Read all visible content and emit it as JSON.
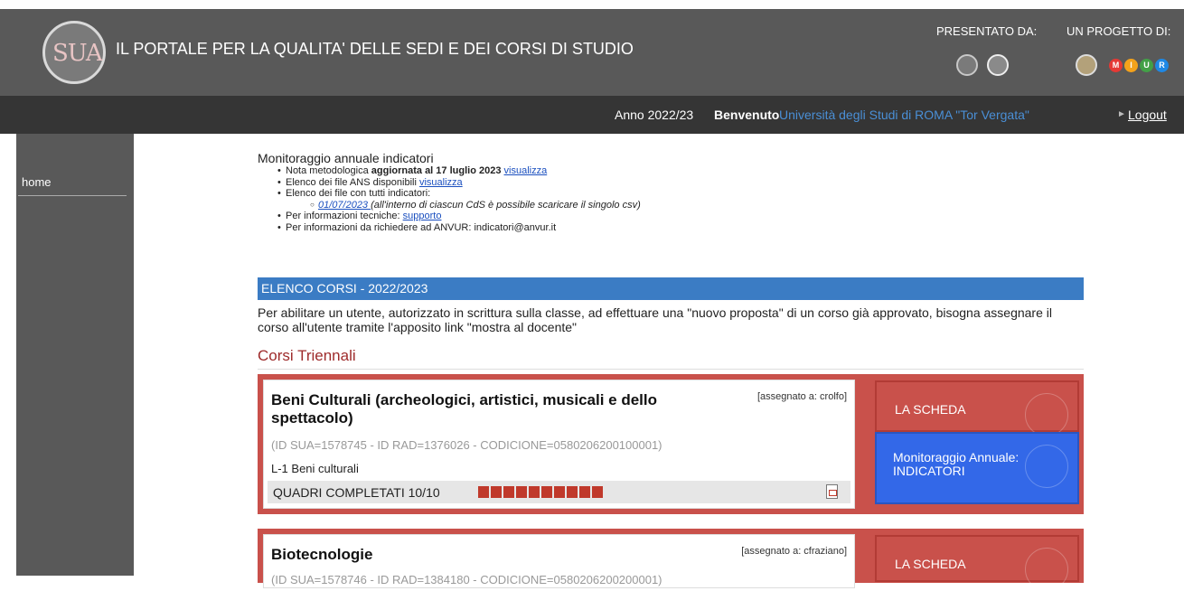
{
  "header": {
    "logo_text": "SUA",
    "title": "IL PORTALE PER LA QUALITA' DELLE SEDI E DEI CORSI DI STUDIO",
    "presented_by": "PRESENTATO DA:",
    "project_of": "UN PROGETTO DI:",
    "miur_letters": [
      "M",
      "I",
      "U",
      "R"
    ],
    "miur_colors": [
      "#e53935",
      "#f4a21b",
      "#43a047",
      "#1e88e5"
    ]
  },
  "topbar": {
    "year": "Anno 2022/23",
    "welcome": "Benvenuto",
    "university": "Università degli Studi di ROMA \"Tor Vergata\"",
    "logout": "Logout"
  },
  "sidebar": {
    "home": "home"
  },
  "monitoring": {
    "title": "Monitoraggio annuale indicatori",
    "item1_pre": "Nota metodologica ",
    "item1_bold": "aggiornata al 17 luglio 2023",
    "item1_link": "visualizza",
    "item2_pre": "Elenco dei file ANS disponibili ",
    "item2_link": "visualizza",
    "item3": "Elenco dei file con tutti indicatori:",
    "item3a_link": "01/07/2023 ",
    "item3a_note": "(all'interno di ciascun CdS è possibile scaricare il singolo csv)",
    "item4_pre": "Per informazioni tecniche: ",
    "item4_link": "supporto",
    "item5": "Per informazioni da richiedere ad ANVUR: indicatori@anvur.it"
  },
  "list": {
    "banner": "ELENCO CORSI - 2022/2023",
    "paragraph": "Per abilitare un utente, autorizzato in scrittura sulla classe, ad effettuare una \"nuovo proposta\" di un corso già approvato, bisogna assegnare il corso all'utente tramite l'apposito link \"mostra al docente\"",
    "section_title": "Corsi Triennali"
  },
  "courses": [
    {
      "name": "Beni Culturali (archeologici, artistici, musicali e dello spettacolo)",
      "assigned": "[assegnato a: crolfo]",
      "ids": "(ID SUA=1578745 - ID RAD=1376026 - CODICIONE=0580206200100001)",
      "classe": "L-1 Beni culturali",
      "quadri": "QUADRI COMPLETATI 10/10",
      "quadri_completed": 10,
      "quadri_total": 10,
      "btn_scheda": "LA SCHEDA",
      "btn_monitor": "Monitoraggio Annuale: INDICATORI"
    },
    {
      "name": "Biotecnologie",
      "assigned": "[assegnato a: cfraziano]",
      "ids": "(ID SUA=1578746 - ID RAD=1384180 - CODICIONE=0580206200200001)",
      "btn_scheda": "LA SCHEDA"
    }
  ]
}
